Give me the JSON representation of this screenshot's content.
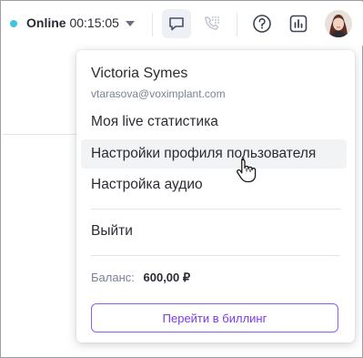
{
  "topbar": {
    "status_label": "Online",
    "status_timer": "00:15:05",
    "status_color": "#3ec6e0",
    "icons": [
      "chat-icon",
      "phone-dialpad-icon",
      "help-icon",
      "statistics-icon"
    ]
  },
  "user": {
    "name": "Victoria Symes",
    "email": "vtarasova@voximplant.com"
  },
  "menu": {
    "items": [
      "Моя live статистика",
      "Настройки профиля пользователя",
      "Настройка аудио"
    ],
    "logout": "Выйти"
  },
  "balance": {
    "label": "Баланс:",
    "value": "600,00 ₽"
  },
  "billing_button": "Перейти в биллинг",
  "colors": {
    "accent": "#7c3aed",
    "online": "#3ec6e0"
  }
}
